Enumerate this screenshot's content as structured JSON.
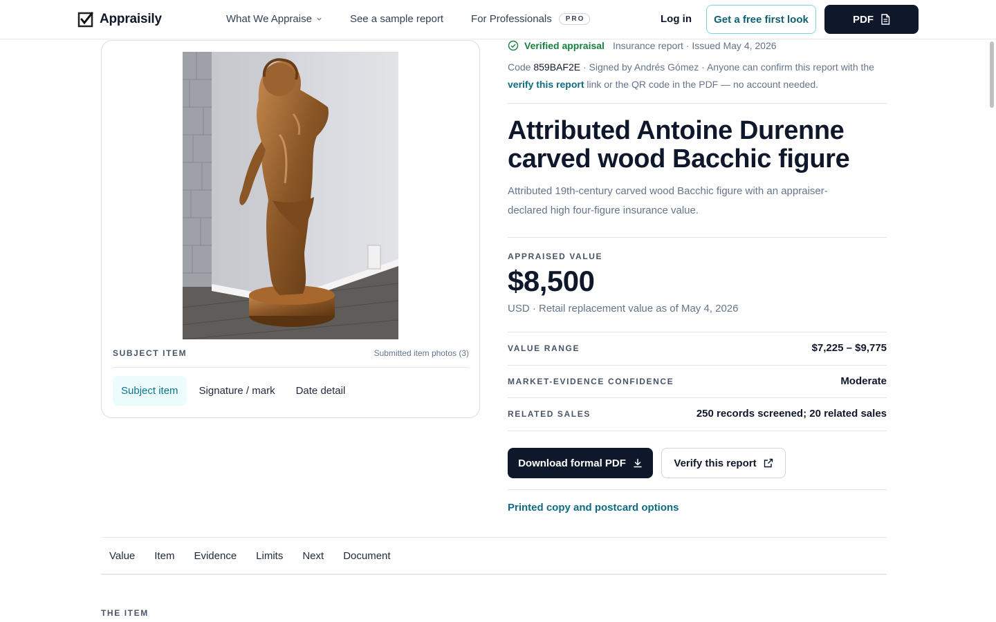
{
  "nav": {
    "brand": "Appraisily",
    "links": {
      "what_we_appraise": "What We Appraise",
      "sample_report": "See a sample report",
      "for_professionals": "For Professionals",
      "pro_badge": "PRO"
    },
    "login": "Log in",
    "first_look": "Get a free first look",
    "pdf": "PDF"
  },
  "photo_card": {
    "caption_label": "SUBJECT ITEM",
    "caption_count": "Submitted item photos (3)",
    "tabs": [
      "Subject item",
      "Signature / mark",
      "Date detail"
    ],
    "active_tab": "Subject item"
  },
  "report": {
    "verified_label": "Verified appraisal",
    "verified_meta": "Insurance report · Issued May 4, 2026",
    "code_prefix": "Code",
    "code": "859BAF2E",
    "code_suffix": "· Signed by Andrés Gómez · Anyone can confirm this report with the",
    "verify_link": "verify this report",
    "code_tail": "link or the QR code in the PDF — no account needed.",
    "title": "Attributed Antoine Durenne carved wood Bacchic figure",
    "subtitle": "Attributed 19th-century carved wood Bacchic figure with an appraiser-declared high four-figure insurance value.",
    "value_label": "APPRAISED VALUE",
    "value": "$8,500",
    "value_note": "USD · Retail replacement value as of May 4, 2026",
    "details": [
      {
        "key": "VALUE RANGE",
        "value": "$7,225 – $9,775"
      },
      {
        "key": "MARKET-EVIDENCE CONFIDENCE",
        "value": "Moderate"
      },
      {
        "key": "RELATED SALES",
        "value": "250 records screened; 20 related sales"
      }
    ],
    "download_button": "Download formal PDF",
    "verify_button": "Verify this report",
    "print_link": "Printed copy and postcard options"
  },
  "section_tabs": [
    "Value",
    "Item",
    "Evidence",
    "Limits",
    "Next",
    "Document"
  ],
  "section_heading": "THE ITEM",
  "colors": {
    "dark": "#0f172a",
    "teal_link": "#0e6b83",
    "verified_green": "#16803c",
    "muted_text": "#64748b"
  }
}
